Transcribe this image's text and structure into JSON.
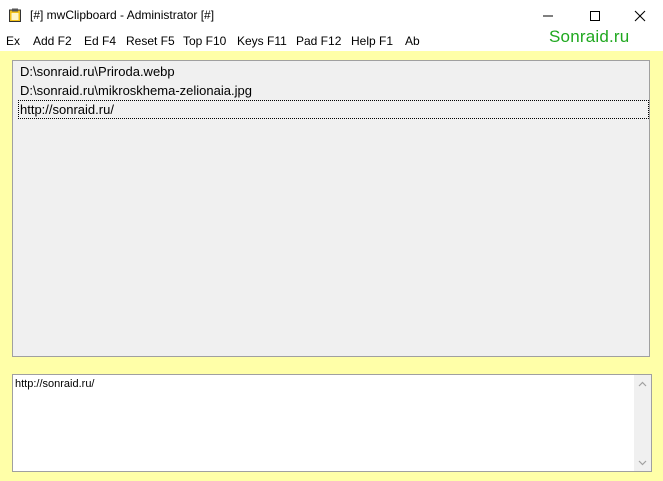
{
  "window": {
    "title": "[#] mwClipboard - Administrator [#]",
    "icons": {
      "app": "clipboard-icon",
      "minimize": "minimize-icon",
      "maximize": "maximize-icon",
      "close": "close-icon"
    }
  },
  "menu": {
    "items": [
      "Ex",
      "Add F2",
      "Ed F4",
      "Reset F5",
      "Top F10",
      "Keys F11",
      "Pad F12",
      "Help F1",
      "Ab"
    ]
  },
  "brand": {
    "text": "Sonraid.ru",
    "color": "#1fa81f"
  },
  "clipboard_list": {
    "items": [
      "D:\\sonraid.ru\\Priroda.webp",
      "D:\\sonraid.ru\\mikroskhema-zelionaia.jpg",
      "http://sonraid.ru/"
    ],
    "focused_index": 2
  },
  "editor": {
    "value": "http://sonraid.ru/"
  },
  "colors": {
    "window_background": "#ffffa8",
    "list_background": "#f0f0f0"
  }
}
